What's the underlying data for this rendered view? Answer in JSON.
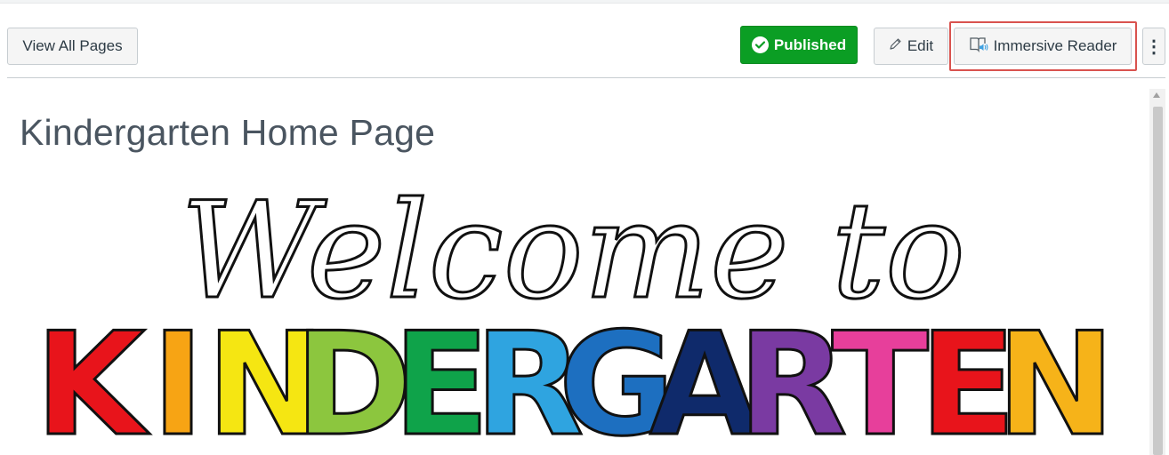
{
  "toolbar": {
    "view_all_label": "View All Pages",
    "published_label": "Published",
    "edit_label": "Edit",
    "immersive_reader_label": "Immersive Reader",
    "more_label": "⋮",
    "icons": {
      "published": "check-circle-icon",
      "edit": "pencil-icon",
      "immersive_reader": "immersive-reader-icon"
    }
  },
  "page": {
    "title": "Kindergarten Home Page"
  },
  "banner": {
    "script_text": "Welcome to",
    "letters": [
      "K",
      "I",
      "N",
      "D",
      "E",
      "R",
      "G",
      "A",
      "R",
      "T",
      "E",
      "N"
    ],
    "letter_colors": [
      "#e8141b",
      "#f7a414",
      "#f5e612",
      "#8cc63e",
      "#0fa34a",
      "#2fa4e0",
      "#1d6fc0",
      "#0f2a6b",
      "#7a3aa2",
      "#e73f9b",
      "#e8141b",
      "#f6b319"
    ]
  },
  "colors": {
    "published_green": "#0b9e24",
    "highlight_red": "#d9534f",
    "title_gray": "#4a5560"
  }
}
